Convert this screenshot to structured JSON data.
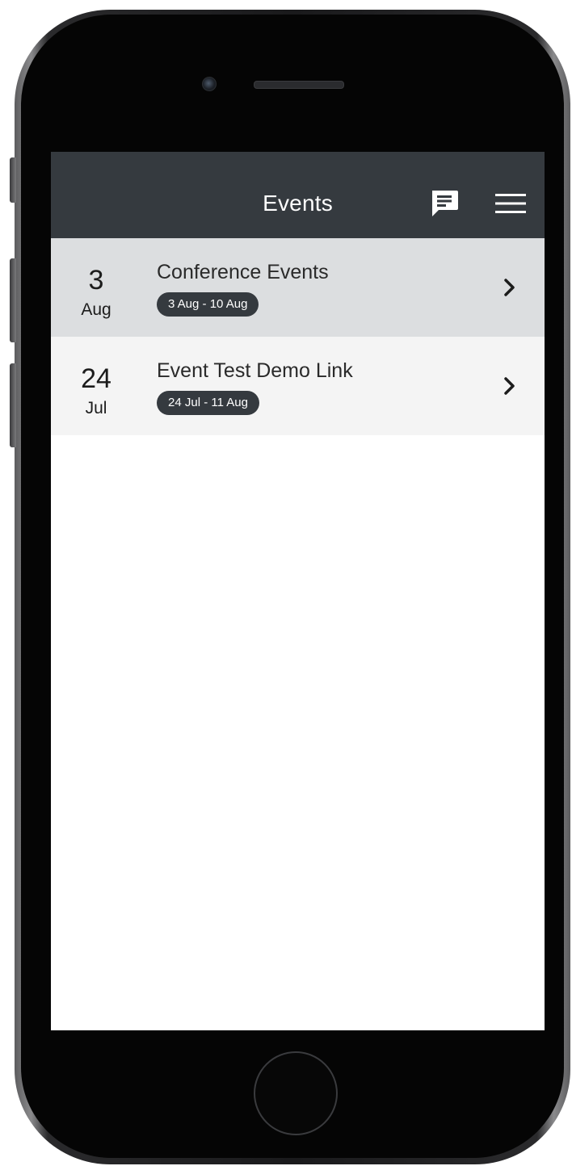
{
  "colors": {
    "appbar_bg": "#353a3f",
    "selected_row_bg": "#dcdee0",
    "row_bg": "#f4f4f4",
    "pill_bg": "#353a3f"
  },
  "header": {
    "title": "Events",
    "chat_icon": "chat-icon",
    "menu_icon": "hamburger-menu-icon"
  },
  "events": [
    {
      "day": "3",
      "month": "Aug",
      "title": "Conference Events",
      "range": "3 Aug - 10 Aug",
      "selected": true,
      "icon": "chevron-right-icon"
    },
    {
      "day": "24",
      "month": "Jul",
      "title": "Event Test Demo Link",
      "range": "24 Jul - 11 Aug",
      "selected": false,
      "icon": "chevron-right-icon"
    }
  ]
}
